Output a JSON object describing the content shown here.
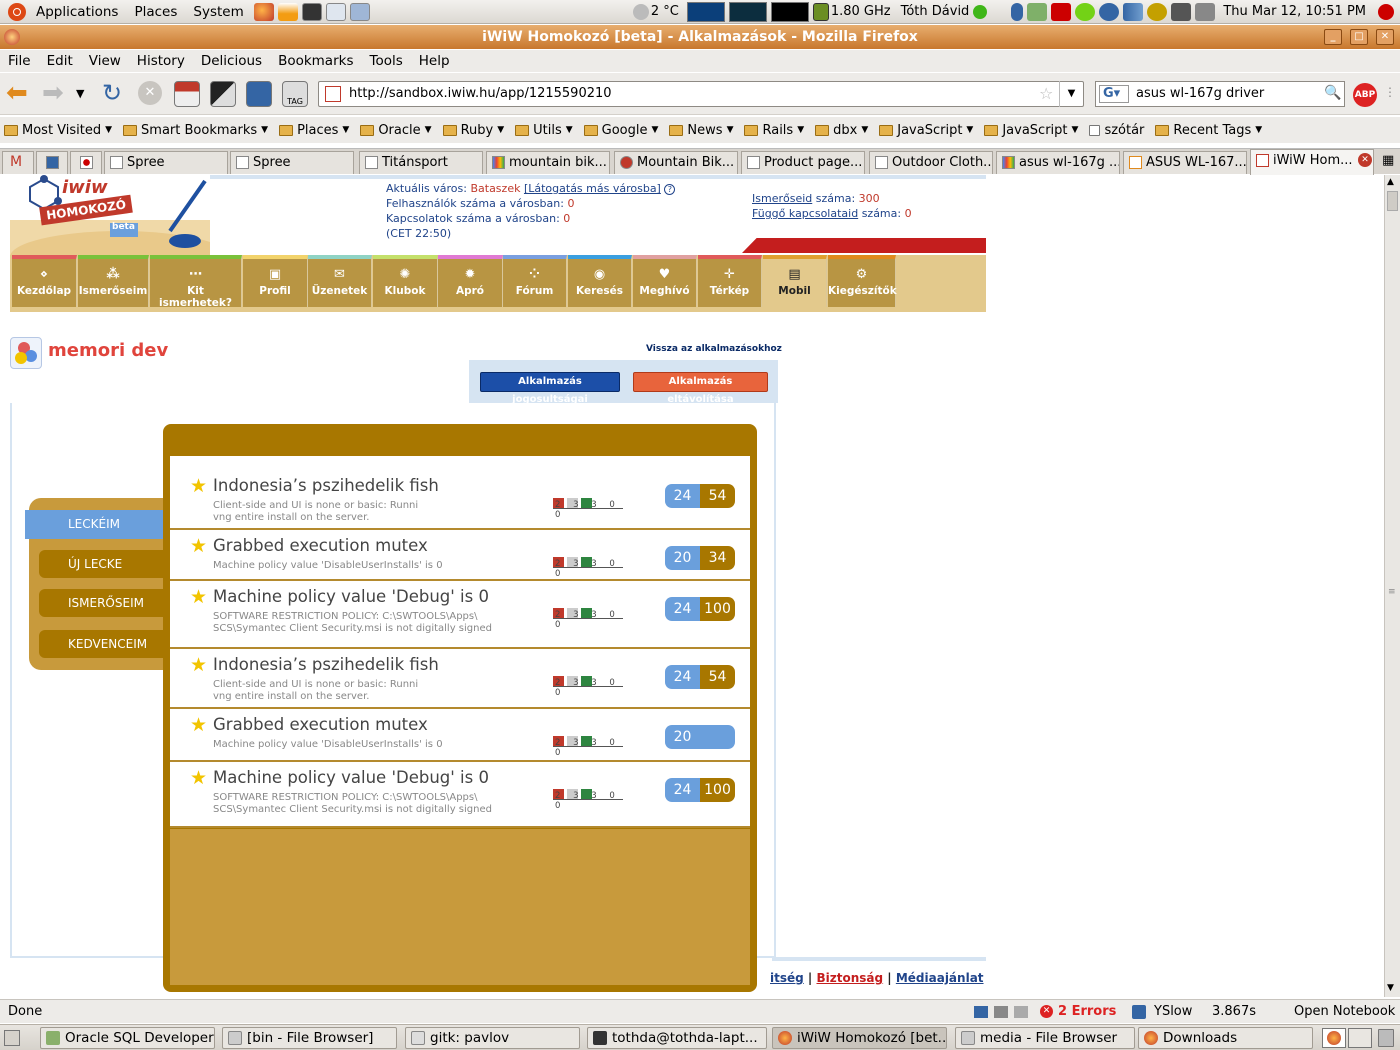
{
  "panel": {
    "menus": [
      "Applications",
      "Places",
      "System"
    ],
    "weather": "2 °C",
    "cpu_freq": "1.80 GHz",
    "user": "Tóth Dávid",
    "clock": "Thu Mar 12, 10:51 PM"
  },
  "window": {
    "title": "iWiW Homokozó [beta] - Alkalmazások - Mozilla Firefox"
  },
  "menubar": [
    "File",
    "Edit",
    "View",
    "History",
    "Delicious",
    "Bookmarks",
    "Tools",
    "Help"
  ],
  "nav": {
    "url": "http://sandbox.iwiw.hu/app/1215590210",
    "search": "asus wl-167g driver"
  },
  "bookmarks": [
    {
      "label": "Most Visited",
      "menu": true
    },
    {
      "label": "Smart Bookmarks",
      "menu": true
    },
    {
      "label": "Places",
      "menu": true
    },
    {
      "label": "Oracle",
      "menu": true
    },
    {
      "label": "Ruby",
      "menu": true
    },
    {
      "label": "Utils",
      "menu": true
    },
    {
      "label": "Google",
      "menu": true
    },
    {
      "label": "News",
      "menu": true
    },
    {
      "label": "Rails",
      "menu": true
    },
    {
      "label": "dbx",
      "menu": true
    },
    {
      "label": "JavaScript",
      "menu": true
    },
    {
      "label": "JavaScript",
      "menu": true
    },
    {
      "label": "szótár",
      "menu": false
    },
    {
      "label": "Recent Tags",
      "menu": true
    }
  ],
  "tabs": [
    "Spree",
    "Spree",
    "Titánsport",
    "mountain bik...",
    "Mountain Bik...",
    "Product page...",
    "Outdoor Cloth...",
    "asus wl-167g ...",
    "ASUS WL-167...",
    "iWiW Hom..."
  ],
  "site": {
    "logo_text": "iwiw",
    "logo_sub": "HOMOKOZÓ",
    "logo_beta": "beta",
    "info": {
      "city_label": "Aktuális város:",
      "city": "Bataszek",
      "visit": "[Látogatás más városba]",
      "users_label": "Felhasználók száma a városban:",
      "users": "0",
      "conn_label": "Kapcsolatok száma a városban:",
      "conn": "0",
      "time": "(CET 22:50)",
      "friends_link": "Ismerőseid",
      "friends_label": "száma:",
      "friends": "300",
      "pending_link": "Függő kapcsolataid",
      "pending_label": "száma:",
      "pending": "0"
    },
    "navitems": [
      "Kezdőlap",
      "Ismerőseim",
      "Kit ismerhetek?",
      "Profil",
      "Üzenetek",
      "Klubok",
      "Apró",
      "Fórum",
      "Keresés",
      "Meghívó",
      "Térkép",
      "Mobil",
      "Kiegészítők"
    ],
    "app_title": "memori dev",
    "back_link": "Vissza az alkalmazásokhoz",
    "btn_perms": "Alkalmazás jogosultságai",
    "btn_remove": "Alkalmazás eltávolítása",
    "side": [
      "LECKÉIM",
      "ÚJ LECKE",
      "ISMERŐSEIM",
      "KEDVENCEIM"
    ],
    "rows": [
      {
        "title": "Indonesia’s pszihedelik fish",
        "desc": [
          "Client-side and UI is none or basic: Runni",
          "vng entire install on the server."
        ],
        "spark": "2 3 3 0 0",
        "a": "24",
        "b": "54"
      },
      {
        "title": "Grabbed execution mutex",
        "desc": [
          "Machine policy value 'DisableUserInstalls' is 0"
        ],
        "spark": "2 3 3 0 0",
        "a": "20",
        "b": "34"
      },
      {
        "title": "Machine policy value 'Debug' is 0",
        "desc": [
          "SOFTWARE RESTRICTION POLICY: C:\\SWTOOLS\\Apps\\",
          "SCS\\Symantec Client Security.msi is not digitally signed"
        ],
        "spark": "2 3 3 0 0",
        "a": "24",
        "b": "100"
      },
      {
        "title": "Indonesia’s pszihedelik fish",
        "desc": [
          "Client-side and UI is none or basic: Runni",
          "vng entire install on the server."
        ],
        "spark": "2 3 3 0 0",
        "a": "24",
        "b": "54"
      },
      {
        "title": "Grabbed execution mutex",
        "desc": [
          "Machine policy value 'DisableUserInstalls' is 0"
        ],
        "spark": "2 3 3 0 0",
        "a": "20",
        "b": ""
      },
      {
        "title": "Machine policy value 'Debug' is 0",
        "desc": [
          "SOFTWARE RESTRICTION POLICY: C:\\SWTOOLS\\Apps\\",
          "SCS\\Symantec Client Security.msi is not digitally signed"
        ],
        "spark": "2 3 3 0 0",
        "a": "24",
        "b": "100"
      }
    ],
    "footer": {
      "l1": "itség",
      "l2": "Biztonság",
      "l3": "Médiaajánlat"
    }
  },
  "status": {
    "text": "Done",
    "errors": "2 Errors",
    "yslow": "YSlow",
    "time": "3.867s",
    "notebook": "Open Notebook"
  },
  "taskbar": [
    "Oracle SQL Developer",
    "[bin - File Browser]",
    "gitk: pavlov",
    "tothda@tothda-lapt...",
    "iWiW Homokozó [bet...",
    "media - File Browser",
    "Downloads"
  ]
}
